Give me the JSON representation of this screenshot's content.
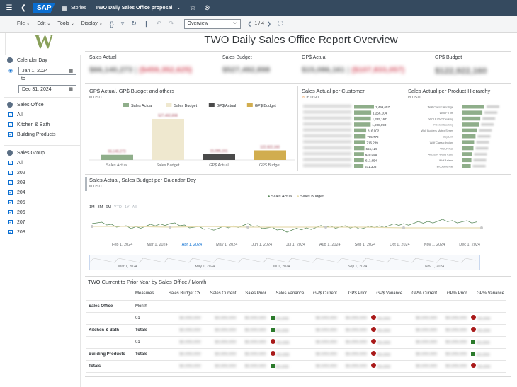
{
  "shell": {
    "app_label": "Stories",
    "story_title": "TWO Daily Sales Office proposal",
    "logo_text": "SAP"
  },
  "toolbar": {
    "file": "File",
    "edit": "Edit",
    "tools": "Tools",
    "display": "Display",
    "page_select": "Overview",
    "page_num": "1 / 4"
  },
  "report": {
    "title": "TWO Daily Sales Office Report Overview"
  },
  "filters": {
    "calendar_day_label": "Calendar Day",
    "date_from": "Jan 1, 2024",
    "date_to_label": "to",
    "date_to": "Dec 31, 2024",
    "sales_office_label": "Sales Office",
    "sales_office_items": [
      "All",
      "Kitchen & Bath",
      "Building Products"
    ],
    "sales_group_label": "Sales Group",
    "sales_group_items": [
      "All",
      "202",
      "203",
      "204",
      "205",
      "206",
      "207",
      "208"
    ]
  },
  "kpis": {
    "sales_actual_label": "Sales Actual",
    "sales_actual_value": "$66,140,273",
    "sales_actual_delta": "($459,352,625)",
    "sales_budget_label": "Sales Budget",
    "sales_budget_value": "$527,492,898",
    "gps_actual_label": "GP$ Actual",
    "gps_actual_value": "$15,086,161",
    "gps_actual_delta": "($107,833,057)",
    "gps_budget_label": "GP$ Budget",
    "gps_budget_value": "$122,922,160"
  },
  "charts": {
    "bar_title": "GP$ Actual, GP$ Budget and others",
    "bar_unit": "in USD",
    "customer_title": "Sales Actual per Customer",
    "customer_unit": "in USD",
    "hierarchy_title": "Sales Actual per Product Hierarchy",
    "hierarchy_unit": "in USD",
    "line_title": "Sales Actual, Sales Budget per Calendar Day",
    "line_unit": "in USD",
    "line_legend_actual": "Sales Actual",
    "line_legend_budget": "Sales Budget",
    "range_buttons": [
      "1M",
      "3M",
      "6M",
      "YTD",
      "1Y",
      "All"
    ],
    "x_ticks": [
      "Feb 1, 2024",
      "Mar 1, 2024",
      "Apr 1, 2024",
      "May 1, 2024",
      "Jun 1, 2024",
      "Jul 1, 2024",
      "Aug 1, 2024",
      "Sep 1, 2024",
      "Oct 1, 2024",
      "Nov 1, 2024",
      "Dec 1, 2024"
    ],
    "nav_ticks": [
      "Mar 1, 2024",
      "May 1, 2024",
      "Jul 1, 2024",
      "Sep 1, 2024",
      "Nov 1, 2024"
    ]
  },
  "chart_data": [
    {
      "type": "bar",
      "title": "GP$ Actual, GP$ Budget and others",
      "categories": [
        "Sales Actual",
        "Sales Budget",
        "GP$ Actual",
        "GP$ Budget"
      ],
      "series": [
        {
          "name": "Sales Actual",
          "values": [
            66140273,
            0,
            0,
            0
          ]
        },
        {
          "name": "Sales Budget",
          "values": [
            0,
            527492898,
            0,
            0
          ]
        },
        {
          "name": "GP$ Actual",
          "values": [
            0,
            0,
            15086161,
            0
          ]
        },
        {
          "name": "GP$ Budget",
          "values": [
            0,
            0,
            0,
            122922160
          ]
        }
      ],
      "bar_labels": [
        "66,140,273",
        "527,492,898",
        "15,086,161",
        "122,922,160"
      ],
      "colors": [
        "#8fae8a",
        "#efe8cf",
        "#4a4a4a",
        "#d1ad4f"
      ],
      "ylim": [
        0,
        600000000
      ]
    },
    {
      "type": "bar",
      "title": "Sales Actual per Customer",
      "values": [
        1499657,
        1256104,
        1225167,
        1208090,
        816002,
        765779,
        716289,
        656125,
        620055,
        613654,
        571308
      ],
      "labels": [
        "1,499,657",
        "1,256,104",
        "1,225,167",
        "1,208,090",
        "816,002",
        "765,779",
        "716,289",
        "656,125",
        "620,055",
        "613,654",
        "571,308"
      ]
    },
    {
      "type": "bar",
      "title": "Sales Actual per Product Hierarchy",
      "categories": [
        "Wolf Classic Heritage",
        "WOLF Trim",
        "WOLF PVC Decking",
        "Fiberon Decking",
        "Wolf Builders Matrix Series",
        "Bay Link",
        "Wolf Classic Instant",
        "WOLF Rail",
        "Ancestry Wood Cabs",
        "Wolf Artisan",
        "Brookline Rail"
      ],
      "values": [
        33,
        30,
        27,
        25,
        22,
        20,
        18,
        17,
        15,
        14,
        13
      ]
    },
    {
      "type": "line",
      "title": "Sales Actual, Sales Budget per Calendar Day",
      "series": [
        {
          "name": "Sales Actual",
          "values": [
            38,
            30,
            36,
            28,
            34,
            26,
            32,
            30,
            35,
            40,
            37
          ]
        },
        {
          "name": "Sales Budget",
          "values": [
            30,
            30,
            29,
            30,
            29,
            29,
            29,
            29,
            28,
            28,
            28
          ]
        }
      ],
      "x": [
        "Feb 1, 2024",
        "Mar 1, 2024",
        "Apr 1, 2024",
        "May 1, 2024",
        "Jun 1, 2024",
        "Jul 1, 2024",
        "Aug 1, 2024",
        "Sep 1, 2024",
        "Oct 1, 2024",
        "Nov 1, 2024",
        "Dec 1, 2024"
      ]
    }
  ],
  "table": {
    "title": "TWO Current to Prior Year by Sales Office / Month",
    "headers": [
      "Measures",
      "Sales Budget CY",
      "Sales Current",
      "Sales Prior",
      "Sales Variance",
      "GP$ Current",
      "GP$ Prior",
      "GP$ Variance",
      "GP% Current",
      "GP% Prior",
      "GP% Variance"
    ],
    "sales_office_label": "Sales Office",
    "month_label": "Month",
    "rows": [
      {
        "office": "",
        "month": "01",
        "sv": "sq",
        "gv": "dot",
        "pv": "dot"
      },
      {
        "office": "Kitchen & Bath",
        "month": "Totals",
        "sv": "sq",
        "gv": "dot",
        "pv": "dot"
      },
      {
        "office": "",
        "month": "01",
        "sv": "dot",
        "gv": "dot",
        "pv": "sq"
      },
      {
        "office": "Building Products",
        "month": "Totals",
        "sv": "dot",
        "gv": "dot",
        "pv": "sq"
      },
      {
        "office": "Totals",
        "month": "",
        "sv": "sq",
        "gv": "dot",
        "pv": "dot"
      }
    ]
  }
}
